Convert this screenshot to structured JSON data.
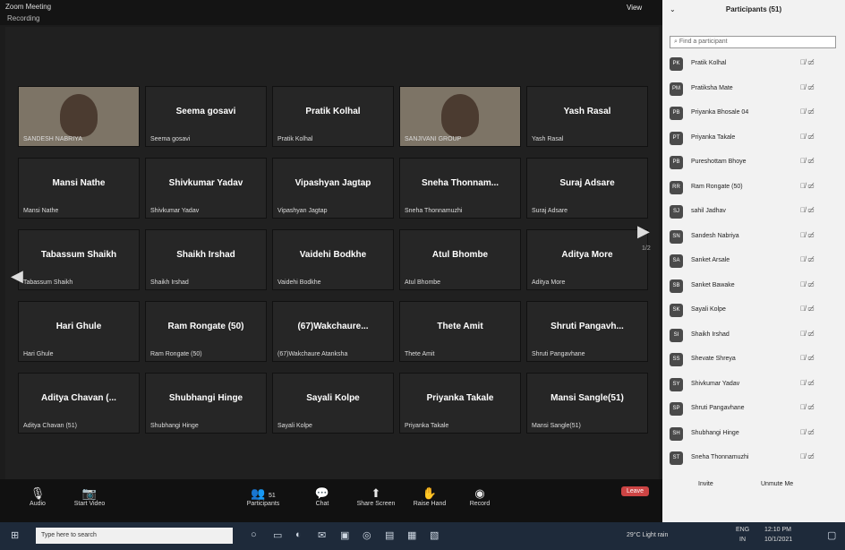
{
  "window_title": "Zoom Meeting",
  "recording_label": "Recording",
  "view_label": "View",
  "page_indicator": "1/2",
  "tiles": [
    {
      "name": "",
      "sub": "SANDESH NABRIYA",
      "video": true
    },
    {
      "name": "Seema gosavi",
      "sub": "Seema gosavi",
      "video": false
    },
    {
      "name": "Pratik Kolhal",
      "sub": "Pratik Kolhal",
      "video": false
    },
    {
      "name": "",
      "sub": "SANJIVANI GROUP",
      "video": true
    },
    {
      "name": "Yash Rasal",
      "sub": "Yash Rasal",
      "video": false
    },
    {
      "name": "Mansi Nathe",
      "sub": "Mansi Nathe",
      "video": false
    },
    {
      "name": "Shivkumar Yadav",
      "sub": "Shivkumar Yadav",
      "video": false
    },
    {
      "name": "Vipashyan Jagtap",
      "sub": "Vipashyan Jagtap",
      "video": false
    },
    {
      "name": "Sneha Thonnam...",
      "sub": "Sneha Thonnamuzhi",
      "video": false
    },
    {
      "name": "Suraj Adsare",
      "sub": "Suraj Adsare",
      "video": false
    },
    {
      "name": "Tabassum Shaikh",
      "sub": "Tabassum Shaikh",
      "video": false
    },
    {
      "name": "Shaikh Irshad",
      "sub": "Shaikh Irshad",
      "video": false
    },
    {
      "name": "Vaidehi Bodkhe",
      "sub": "Vaidehi Bodkhe",
      "video": false
    },
    {
      "name": "Atul Bhombe",
      "sub": "Atul Bhombe",
      "video": false
    },
    {
      "name": "Aditya More",
      "sub": "Aditya More",
      "video": false
    },
    {
      "name": "Hari Ghule",
      "sub": "Hari Ghule",
      "video": false
    },
    {
      "name": "Ram Rongate (50)",
      "sub": "Ram Rongate (50)",
      "video": false
    },
    {
      "name": "(67)Wakchaure...",
      "sub": "(67)Wakchaure Atanksha",
      "video": false
    },
    {
      "name": "Thete Amit",
      "sub": "Thete Amit",
      "video": false
    },
    {
      "name": "Shruti Pangavh...",
      "sub": "Shruti Pangavhane",
      "video": false
    },
    {
      "name": "Aditya Chavan (...",
      "sub": "Aditya Chavan (51)",
      "video": false
    },
    {
      "name": "Shubhangi Hinge",
      "sub": "Shubhangi Hinge",
      "video": false
    },
    {
      "name": "Sayali Kolpe",
      "sub": "Sayali Kolpe",
      "video": false
    },
    {
      "name": "Priyanka Takale",
      "sub": "Priyanka Takale",
      "video": false
    },
    {
      "name": "Mansi Sangle(51)",
      "sub": "Mansi Sangle(51)",
      "video": false
    }
  ],
  "toolbar": {
    "audio": "Audio",
    "video": "Start Video",
    "participants": "Participants",
    "participants_count": "51",
    "chat": "Chat",
    "share": "Share Screen",
    "raise": "Raise Hand",
    "record": "Record",
    "leave": "Leave"
  },
  "panel": {
    "title": "Participants (51)",
    "search_placeholder": "Find a participant",
    "invite": "Invite",
    "unmute": "Unmute Me",
    "participants": [
      {
        "initials": "PK",
        "name": "Pratik Kolhal"
      },
      {
        "initials": "PM",
        "name": "Pratiksha Mate"
      },
      {
        "initials": "PB",
        "name": "Priyanka Bhosale 04"
      },
      {
        "initials": "PT",
        "name": "Priyanka Takale"
      },
      {
        "initials": "PB",
        "name": "Pureshottam Bhoye"
      },
      {
        "initials": "RR",
        "name": "Ram Rongate (50)"
      },
      {
        "initials": "SJ",
        "name": "sahil Jadhav"
      },
      {
        "initials": "SN",
        "name": "Sandesh Nabriya"
      },
      {
        "initials": "SA",
        "name": "Sanket Arsale"
      },
      {
        "initials": "SB",
        "name": "Sanket Bawake"
      },
      {
        "initials": "SK",
        "name": "Sayali Kolpe"
      },
      {
        "initials": "SI",
        "name": "Shaikh Irshad"
      },
      {
        "initials": "SS",
        "name": "Shevate Shreya"
      },
      {
        "initials": "SY",
        "name": "Shivkumar Yadav"
      },
      {
        "initials": "SP",
        "name": "Shruti Pangavhane"
      },
      {
        "initials": "SH",
        "name": "Shubhangi Hinge"
      },
      {
        "initials": "ST",
        "name": "Sneha Thonnamuzhi"
      }
    ]
  },
  "taskbar": {
    "search": "Type here to search",
    "weather": "29°C Light rain",
    "lang": "ENG",
    "region": "IN",
    "time": "12:10 PM",
    "date": "10/1/2021"
  }
}
